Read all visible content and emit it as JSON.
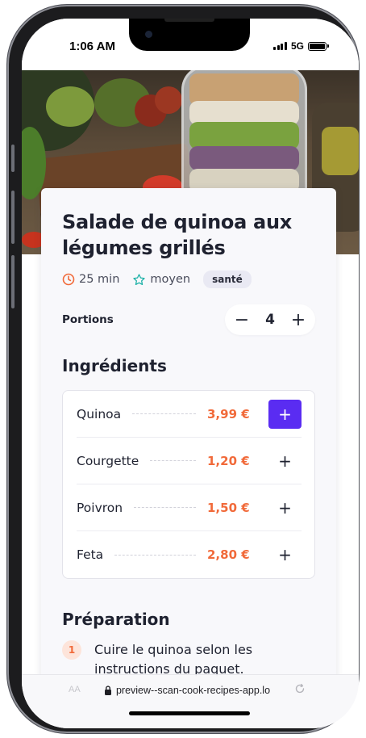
{
  "status_bar": {
    "time": "1:06 AM",
    "network": "5G"
  },
  "recipe": {
    "title": "Salade de quinoa aux légumes grillés",
    "duration": "25 min",
    "difficulty": "moyen",
    "tag": "santé"
  },
  "portions": {
    "label": "Portions",
    "value": "4",
    "minus": "−",
    "plus": "+"
  },
  "ingredients": {
    "title": "Ingrédients",
    "items": [
      {
        "name": "Quinoa",
        "price": "3,99 €",
        "add": "+"
      },
      {
        "name": "Courgette",
        "price": "1,20 €",
        "add": "+"
      },
      {
        "name": "Poivron",
        "price": "1,50 €",
        "add": "+"
      },
      {
        "name": "Feta",
        "price": "2,80 €",
        "add": "+"
      }
    ]
  },
  "preparation": {
    "title": "Préparation",
    "steps": [
      {
        "number": "1",
        "text": "Cuire le quinoa selon les instructions du paquet."
      }
    ]
  },
  "browser": {
    "text_size_label": "AA",
    "url": "preview--scan-cook-recipes-app.lo"
  },
  "colors": {
    "accent": "#5a2cf2",
    "price": "#f16a3a",
    "clock_icon": "#f16a3a",
    "star_icon": "#1ab0a6"
  }
}
